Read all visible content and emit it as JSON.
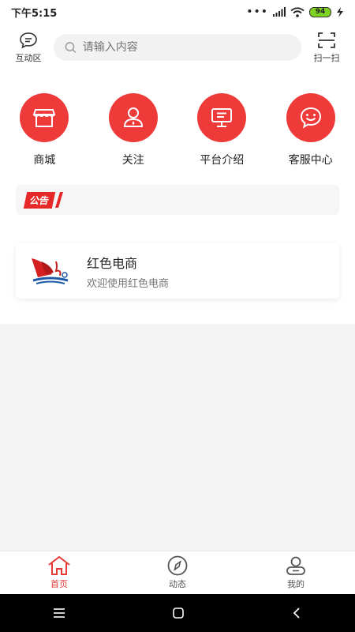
{
  "status_bar": {
    "time": "下午5:15",
    "battery": "94"
  },
  "header": {
    "left_label": "互动区",
    "search_placeholder": "请输入内容",
    "right_label": "扫一扫"
  },
  "menu": [
    {
      "label": "商城",
      "icon": "store-icon"
    },
    {
      "label": "关注",
      "icon": "user-icon"
    },
    {
      "label": "平台介绍",
      "icon": "monitor-icon"
    },
    {
      "label": "客服中心",
      "icon": "smile-chat-icon"
    }
  ],
  "notice": {
    "tag": "公告"
  },
  "card": {
    "title": "红色电商",
    "subtitle": "欢迎使用红色电商"
  },
  "tabs": [
    {
      "label": "首页",
      "icon": "home-icon"
    },
    {
      "label": "动态",
      "icon": "compass-icon"
    },
    {
      "label": "我的",
      "icon": "profile-icon"
    }
  ],
  "colors": {
    "accent": "#ef3a3a",
    "active_tab": "#e53935"
  }
}
